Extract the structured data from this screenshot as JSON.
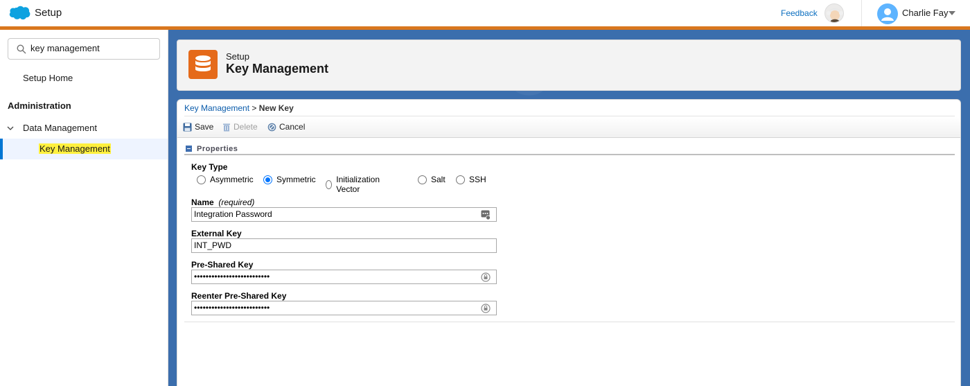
{
  "app": {
    "title": "Setup"
  },
  "header": {
    "feedback_label": "Feedback",
    "user_name": "Charlie Fay"
  },
  "sidebar": {
    "search": {
      "value": "key management",
      "placeholder": "Quick Find"
    },
    "setup_home": "Setup Home",
    "section": "Administration",
    "group": "Data Management",
    "active_item": "Key Management"
  },
  "page": {
    "subtitle": "Setup",
    "title": "Key Management",
    "breadcrumb": {
      "link": "Key Management",
      "separator": " > ",
      "current": "New Key"
    },
    "toolbar": {
      "save": "Save",
      "delete": "Delete",
      "cancel": "Cancel"
    },
    "section_title": "Properties",
    "key_type": {
      "label": "Key Type",
      "options": [
        "Asymmetric",
        "Symmetric",
        "Initialization Vector",
        "Salt",
        "SSH"
      ],
      "selected": "Symmetric"
    },
    "name": {
      "label": "Name",
      "required": "(required)",
      "value": "Integration Password"
    },
    "external_key": {
      "label": "External Key",
      "value": "INT_PWD"
    },
    "pre_shared_key": {
      "label": "Pre-Shared Key",
      "value": "••••••••••••••••••••••••••"
    },
    "reenter_key": {
      "label": "Reenter Pre-Shared Key",
      "value": "••••••••••••••••••••••••••"
    }
  },
  "colors": {
    "brand_blue": "#0176d3",
    "accent_orange": "#d9771e",
    "header_icon_orange": "#e56a1a",
    "highlight_yellow": "#fff03f",
    "page_background_blue": "#3b6ead"
  }
}
